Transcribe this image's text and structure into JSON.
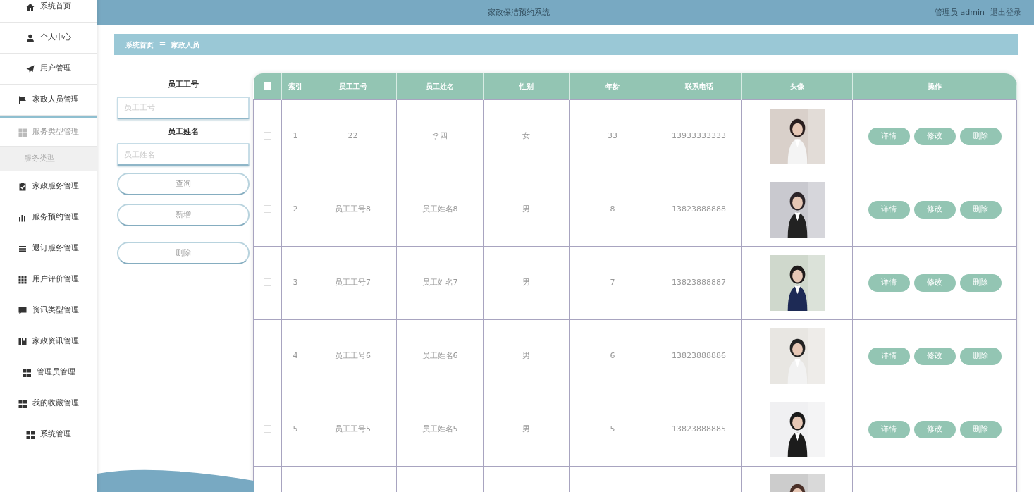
{
  "sidebar": {
    "items": [
      {
        "label": "系统首页",
        "expanded": false
      },
      {
        "label": "个人中心",
        "expanded": false
      },
      {
        "label": "用户管理",
        "expanded": false
      },
      {
        "label": "家政人员管理",
        "expanded": false
      },
      {
        "label": "服务类型管理",
        "expanded": true,
        "children": [
          {
            "label": "服务类型",
            "selected": true
          }
        ]
      },
      {
        "label": "家政服务管理",
        "expanded": false
      },
      {
        "label": "服务预约管理",
        "expanded": false
      },
      {
        "label": "退订服务管理",
        "expanded": false
      },
      {
        "label": "用户评价管理",
        "expanded": false
      },
      {
        "label": "资讯类型管理",
        "expanded": false
      },
      {
        "label": "家政资讯管理",
        "expanded": false
      },
      {
        "label": "管理员管理",
        "expanded": false
      },
      {
        "label": "我的收藏管理",
        "expanded": false
      },
      {
        "label": "系统管理",
        "expanded": false
      }
    ]
  },
  "top_bar": {
    "title": "家政保洁预约系统",
    "user": "管理员 admin",
    "logout": "退出登录"
  },
  "breadcrumb": {
    "items": [
      "系统首页",
      "家政人员"
    ],
    "separator": "☰"
  },
  "search_form": {
    "fields": [
      {
        "label": "员工工号",
        "placeholder": "员工工号"
      },
      {
        "label": "员工姓名",
        "placeholder": "员工姓名"
      }
    ],
    "query_button": "查询",
    "add_button": "新增",
    "delete_button": "删除"
  },
  "table": {
    "select_all": {
      "checked": false
    },
    "columns": [
      "索引",
      "员工工号",
      "员工姓名",
      "性别",
      "年龄",
      "联系电话",
      "头像",
      "操作"
    ],
    "rows": [
      {
        "checked": false,
        "index": "1",
        "id": "22",
        "name": "李四",
        "gender": "女",
        "age": "33",
        "phone": "13933333333",
        "actions": [
          "详情",
          "修改",
          "删除"
        ]
      },
      {
        "checked": false,
        "index": "2",
        "id": "员工工号8",
        "name": "员工姓名8",
        "gender": "男",
        "age": "8",
        "phone": "13823888888",
        "actions": [
          "详情",
          "修改",
          "删除"
        ]
      },
      {
        "checked": false,
        "index": "3",
        "id": "员工工号7",
        "name": "员工姓名7",
        "gender": "男",
        "age": "7",
        "phone": "13823888887",
        "actions": [
          "详情",
          "修改",
          "删除"
        ]
      },
      {
        "checked": false,
        "index": "4",
        "id": "员工工号6",
        "name": "员工姓名6",
        "gender": "男",
        "age": "6",
        "phone": "13823888886",
        "actions": [
          "详情",
          "修改",
          "删除"
        ]
      },
      {
        "checked": false,
        "index": "5",
        "id": "员工工号5",
        "name": "员工姓名5",
        "gender": "男",
        "age": "5",
        "phone": "13823888885",
        "actions": [
          "详情",
          "修改",
          "删除"
        ]
      }
    ]
  }
}
